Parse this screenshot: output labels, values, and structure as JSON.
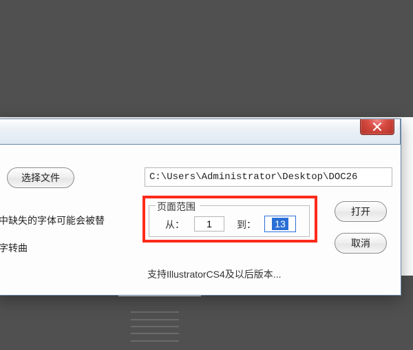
{
  "titlebar": {
    "close_tooltip": "关闭"
  },
  "buttons": {
    "select_file": "选择文件",
    "open": "打开",
    "cancel": "取消"
  },
  "path_field": {
    "value": "C:\\Users\\Administrator\\Desktop\\DOC26"
  },
  "truncated": {
    "line1": "中缺失的字体可能会被替",
    "line2": "字转曲"
  },
  "page_range": {
    "legend": "页面范围",
    "from_label": "从：",
    "to_label": "到：",
    "from_value": "1",
    "to_value": "13"
  },
  "support_text": "支持IllustratorCS4及以后版本..."
}
